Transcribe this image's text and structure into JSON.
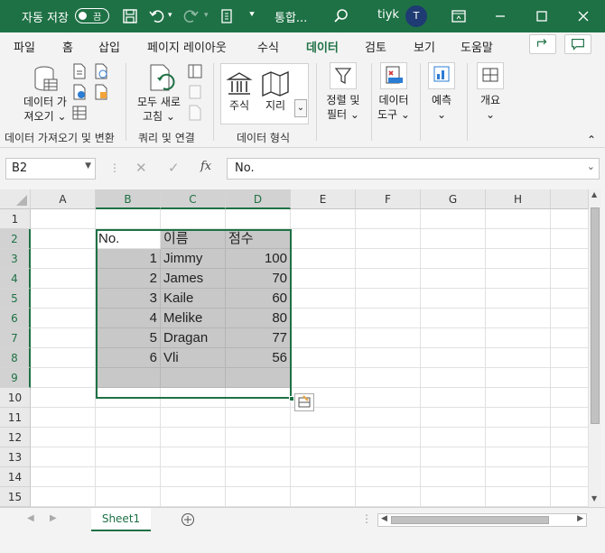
{
  "titlebar": {
    "autosave_label": "자동 저장",
    "autosave_state": "끔",
    "doc_title": "통합...",
    "user_name": "tiyk",
    "avatar_initial": "T"
  },
  "menu": {
    "tabs": [
      "파일",
      "홈",
      "삽입",
      "페이지 레이아웃",
      "수식",
      "데이터",
      "검토",
      "보기",
      "도움말"
    ],
    "active_tab": "데이터"
  },
  "ribbon": {
    "get_data_label_1": "데이터 가",
    "get_data_label_2": "져오기",
    "refresh_all_1": "모두 새로",
    "refresh_all_2": "고침",
    "stocks": "주식",
    "geography": "지리",
    "sort_filter_1": "정렬 및",
    "sort_filter_2": "필터",
    "data_tools_1": "데이터",
    "data_tools_2": "도구",
    "forecast": "예측",
    "outline": "개요",
    "group_get_transform": "데이터 가져오기 및 변환",
    "group_queries": "쿼리 및 연결",
    "group_data_types": "데이터 형식"
  },
  "formula_bar": {
    "name_box": "B2",
    "formula": "No."
  },
  "columns": [
    "A",
    "B",
    "C",
    "D",
    "E",
    "F",
    "G",
    "H"
  ],
  "rows": [
    "1",
    "2",
    "3",
    "4",
    "5",
    "6",
    "7",
    "8",
    "9",
    "10",
    "11",
    "12",
    "13",
    "14",
    "15"
  ],
  "table": {
    "headers": [
      "No.",
      "이름",
      "점수"
    ],
    "rows": [
      [
        "1",
        "Jimmy",
        "100"
      ],
      [
        "2",
        "James",
        "70"
      ],
      [
        "3",
        "Kaile",
        "60"
      ],
      [
        "4",
        "Melike",
        "80"
      ],
      [
        "5",
        "Dragan",
        "77"
      ],
      [
        "6",
        "Vli",
        "56"
      ]
    ]
  },
  "sheets": [
    "Sheet1"
  ],
  "colors": {
    "accent": "#1e7145",
    "selection": "#c8c8c8"
  }
}
